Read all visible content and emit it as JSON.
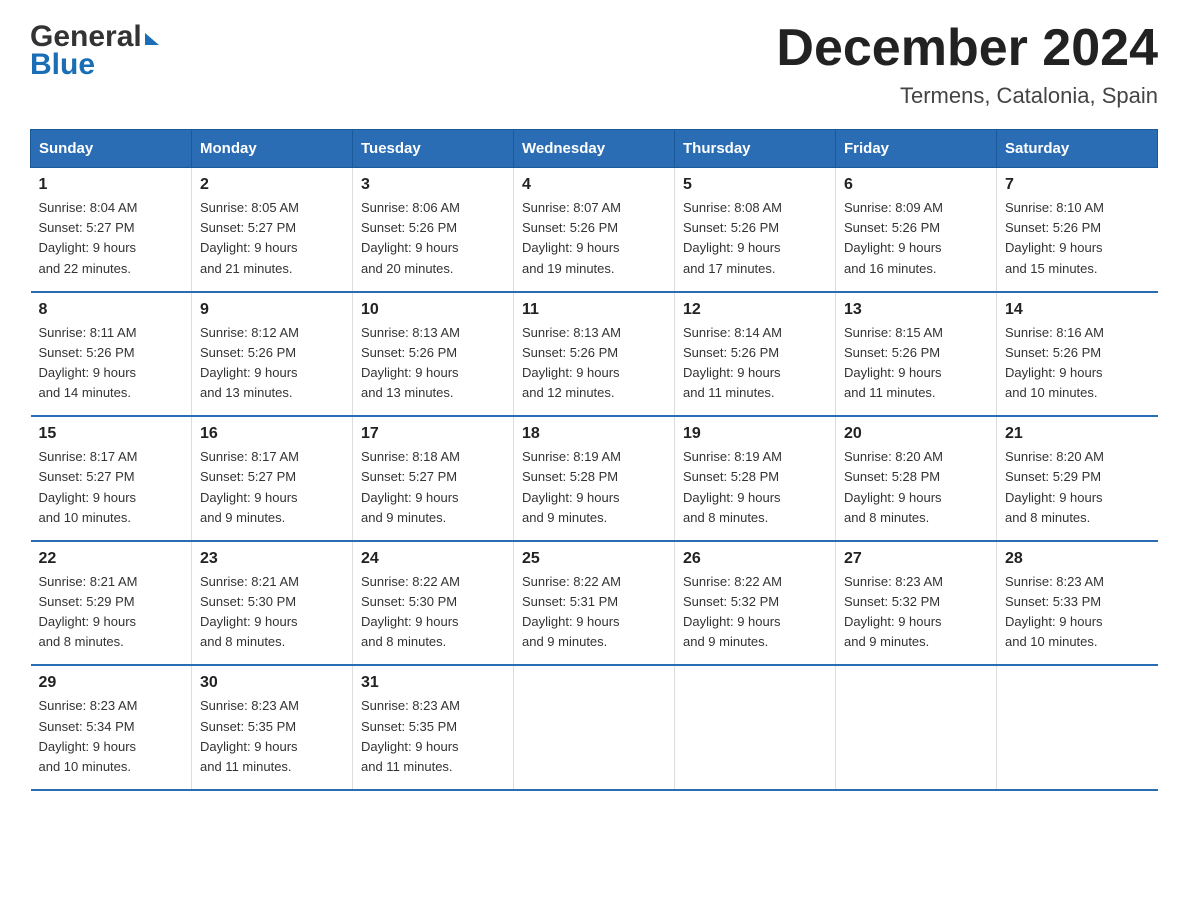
{
  "logo": {
    "general": "General",
    "arrow": "▶",
    "blue": "Blue"
  },
  "title": "December 2024",
  "subtitle": "Termens, Catalonia, Spain",
  "headers": [
    "Sunday",
    "Monday",
    "Tuesday",
    "Wednesday",
    "Thursday",
    "Friday",
    "Saturday"
  ],
  "weeks": [
    [
      {
        "day": "1",
        "info": "Sunrise: 8:04 AM\nSunset: 5:27 PM\nDaylight: 9 hours\nand 22 minutes."
      },
      {
        "day": "2",
        "info": "Sunrise: 8:05 AM\nSunset: 5:27 PM\nDaylight: 9 hours\nand 21 minutes."
      },
      {
        "day": "3",
        "info": "Sunrise: 8:06 AM\nSunset: 5:26 PM\nDaylight: 9 hours\nand 20 minutes."
      },
      {
        "day": "4",
        "info": "Sunrise: 8:07 AM\nSunset: 5:26 PM\nDaylight: 9 hours\nand 19 minutes."
      },
      {
        "day": "5",
        "info": "Sunrise: 8:08 AM\nSunset: 5:26 PM\nDaylight: 9 hours\nand 17 minutes."
      },
      {
        "day": "6",
        "info": "Sunrise: 8:09 AM\nSunset: 5:26 PM\nDaylight: 9 hours\nand 16 minutes."
      },
      {
        "day": "7",
        "info": "Sunrise: 8:10 AM\nSunset: 5:26 PM\nDaylight: 9 hours\nand 15 minutes."
      }
    ],
    [
      {
        "day": "8",
        "info": "Sunrise: 8:11 AM\nSunset: 5:26 PM\nDaylight: 9 hours\nand 14 minutes."
      },
      {
        "day": "9",
        "info": "Sunrise: 8:12 AM\nSunset: 5:26 PM\nDaylight: 9 hours\nand 13 minutes."
      },
      {
        "day": "10",
        "info": "Sunrise: 8:13 AM\nSunset: 5:26 PM\nDaylight: 9 hours\nand 13 minutes."
      },
      {
        "day": "11",
        "info": "Sunrise: 8:13 AM\nSunset: 5:26 PM\nDaylight: 9 hours\nand 12 minutes."
      },
      {
        "day": "12",
        "info": "Sunrise: 8:14 AM\nSunset: 5:26 PM\nDaylight: 9 hours\nand 11 minutes."
      },
      {
        "day": "13",
        "info": "Sunrise: 8:15 AM\nSunset: 5:26 PM\nDaylight: 9 hours\nand 11 minutes."
      },
      {
        "day": "14",
        "info": "Sunrise: 8:16 AM\nSunset: 5:26 PM\nDaylight: 9 hours\nand 10 minutes."
      }
    ],
    [
      {
        "day": "15",
        "info": "Sunrise: 8:17 AM\nSunset: 5:27 PM\nDaylight: 9 hours\nand 10 minutes."
      },
      {
        "day": "16",
        "info": "Sunrise: 8:17 AM\nSunset: 5:27 PM\nDaylight: 9 hours\nand 9 minutes."
      },
      {
        "day": "17",
        "info": "Sunrise: 8:18 AM\nSunset: 5:27 PM\nDaylight: 9 hours\nand 9 minutes."
      },
      {
        "day": "18",
        "info": "Sunrise: 8:19 AM\nSunset: 5:28 PM\nDaylight: 9 hours\nand 9 minutes."
      },
      {
        "day": "19",
        "info": "Sunrise: 8:19 AM\nSunset: 5:28 PM\nDaylight: 9 hours\nand 8 minutes."
      },
      {
        "day": "20",
        "info": "Sunrise: 8:20 AM\nSunset: 5:28 PM\nDaylight: 9 hours\nand 8 minutes."
      },
      {
        "day": "21",
        "info": "Sunrise: 8:20 AM\nSunset: 5:29 PM\nDaylight: 9 hours\nand 8 minutes."
      }
    ],
    [
      {
        "day": "22",
        "info": "Sunrise: 8:21 AM\nSunset: 5:29 PM\nDaylight: 9 hours\nand 8 minutes."
      },
      {
        "day": "23",
        "info": "Sunrise: 8:21 AM\nSunset: 5:30 PM\nDaylight: 9 hours\nand 8 minutes."
      },
      {
        "day": "24",
        "info": "Sunrise: 8:22 AM\nSunset: 5:30 PM\nDaylight: 9 hours\nand 8 minutes."
      },
      {
        "day": "25",
        "info": "Sunrise: 8:22 AM\nSunset: 5:31 PM\nDaylight: 9 hours\nand 9 minutes."
      },
      {
        "day": "26",
        "info": "Sunrise: 8:22 AM\nSunset: 5:32 PM\nDaylight: 9 hours\nand 9 minutes."
      },
      {
        "day": "27",
        "info": "Sunrise: 8:23 AM\nSunset: 5:32 PM\nDaylight: 9 hours\nand 9 minutes."
      },
      {
        "day": "28",
        "info": "Sunrise: 8:23 AM\nSunset: 5:33 PM\nDaylight: 9 hours\nand 10 minutes."
      }
    ],
    [
      {
        "day": "29",
        "info": "Sunrise: 8:23 AM\nSunset: 5:34 PM\nDaylight: 9 hours\nand 10 minutes."
      },
      {
        "day": "30",
        "info": "Sunrise: 8:23 AM\nSunset: 5:35 PM\nDaylight: 9 hours\nand 11 minutes."
      },
      {
        "day": "31",
        "info": "Sunrise: 8:23 AM\nSunset: 5:35 PM\nDaylight: 9 hours\nand 11 minutes."
      },
      null,
      null,
      null,
      null
    ]
  ]
}
